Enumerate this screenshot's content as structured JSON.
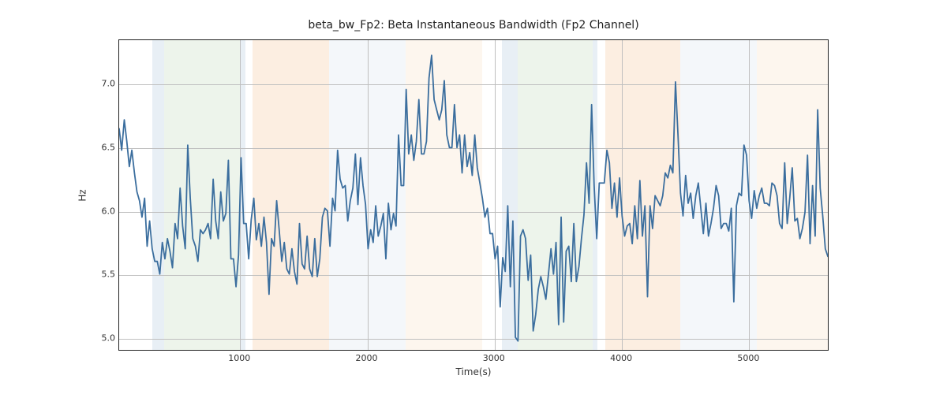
{
  "chart_data": {
    "type": "line",
    "title": "beta_bw_Fp2: Beta Instantaneous Bandwidth (Fp2 Channel)",
    "xlabel": "Time(s)",
    "ylabel": "Hz",
    "xlim": [
      50,
      5630
    ],
    "ylim": [
      4.9,
      7.35
    ],
    "xticks": [
      1000,
      2000,
      3000,
      4000,
      5000
    ],
    "yticks": [
      5.0,
      5.5,
      6.0,
      6.5,
      7.0
    ],
    "line_color": "#3b6e9e",
    "bands": [
      {
        "x0": 310,
        "x1": 405,
        "color": "#b2c9de"
      },
      {
        "x0": 405,
        "x1": 1000,
        "color": "#c3dcbc"
      },
      {
        "x0": 1000,
        "x1": 1040,
        "color": "#b2c9de"
      },
      {
        "x0": 1100,
        "x1": 1700,
        "color": "#f4c89a"
      },
      {
        "x0": 1700,
        "x1": 2300,
        "color": "#dbe6ef"
      },
      {
        "x0": 2300,
        "x1": 2900,
        "color": "#f8e1c8"
      },
      {
        "x0": 3060,
        "x1": 3180,
        "color": "#b2c9de"
      },
      {
        "x0": 3180,
        "x1": 3770,
        "color": "#c3dcbc"
      },
      {
        "x0": 3770,
        "x1": 3810,
        "color": "#b2c9de"
      },
      {
        "x0": 3870,
        "x1": 4460,
        "color": "#f4c89a"
      },
      {
        "x0": 4460,
        "x1": 5060,
        "color": "#dbe6ef"
      },
      {
        "x0": 5060,
        "x1": 5630,
        "color": "#f8e1c8"
      }
    ],
    "series": [
      {
        "name": "beta_bw_Fp2",
        "x": [
          50,
          70,
          90,
          110,
          130,
          150,
          170,
          190,
          210,
          230,
          250,
          270,
          290,
          310,
          330,
          350,
          370,
          390,
          410,
          430,
          450,
          470,
          490,
          510,
          530,
          550,
          570,
          590,
          610,
          630,
          650,
          670,
          690,
          710,
          730,
          750,
          770,
          790,
          810,
          830,
          850,
          870,
          890,
          910,
          930,
          950,
          970,
          990,
          1010,
          1030,
          1050,
          1070,
          1090,
          1110,
          1130,
          1150,
          1170,
          1190,
          1210,
          1230,
          1250,
          1270,
          1290,
          1310,
          1330,
          1350,
          1370,
          1390,
          1410,
          1430,
          1450,
          1470,
          1490,
          1510,
          1530,
          1550,
          1570,
          1590,
          1610,
          1630,
          1650,
          1670,
          1690,
          1710,
          1730,
          1750,
          1770,
          1790,
          1810,
          1830,
          1850,
          1870,
          1890,
          1910,
          1930,
          1950,
          1970,
          1990,
          2010,
          2030,
          2050,
          2070,
          2090,
          2110,
          2130,
          2150,
          2170,
          2190,
          2210,
          2230,
          2250,
          2270,
          2290,
          2310,
          2330,
          2350,
          2370,
          2390,
          2410,
          2430,
          2450,
          2470,
          2490,
          2510,
          2530,
          2550,
          2570,
          2590,
          2610,
          2630,
          2650,
          2670,
          2690,
          2710,
          2730,
          2750,
          2770,
          2790,
          2810,
          2830,
          2850,
          2870,
          2890,
          2910,
          2930,
          2950,
          2970,
          2990,
          3010,
          3030,
          3050,
          3070,
          3090,
          3110,
          3130,
          3150,
          3170,
          3190,
          3210,
          3230,
          3250,
          3270,
          3290,
          3310,
          3330,
          3350,
          3370,
          3390,
          3410,
          3430,
          3450,
          3470,
          3490,
          3510,
          3530,
          3550,
          3570,
          3590,
          3610,
          3630,
          3650,
          3670,
          3690,
          3710,
          3730,
          3750,
          3770,
          3790,
          3810,
          3830,
          3850,
          3870,
          3890,
          3910,
          3930,
          3950,
          3970,
          3990,
          4010,
          4030,
          4050,
          4070,
          4090,
          4110,
          4130,
          4150,
          4170,
          4190,
          4210,
          4230,
          4250,
          4270,
          4290,
          4310,
          4330,
          4350,
          4370,
          4390,
          4410,
          4430,
          4450,
          4470,
          4490,
          4510,
          4530,
          4550,
          4570,
          4590,
          4610,
          4630,
          4650,
          4670,
          4690,
          4710,
          4730,
          4750,
          4770,
          4790,
          4810,
          4830,
          4850,
          4870,
          4890,
          4910,
          4930,
          4950,
          4970,
          4990,
          5010,
          5030,
          5050,
          5070,
          5090,
          5110,
          5130,
          5150,
          5170,
          5190,
          5210,
          5230,
          5250,
          5270,
          5290,
          5310,
          5330,
          5350,
          5370,
          5390,
          5410,
          5430,
          5450,
          5470,
          5490,
          5510,
          5530,
          5550,
          5570,
          5590,
          5610,
          5630
        ],
        "y": [
          6.65,
          6.48,
          6.72,
          6.55,
          6.35,
          6.48,
          6.3,
          6.15,
          6.08,
          5.95,
          6.1,
          5.72,
          5.92,
          5.7,
          5.6,
          5.6,
          5.5,
          5.75,
          5.62,
          5.78,
          5.68,
          5.55,
          5.9,
          5.78,
          6.18,
          5.88,
          5.7,
          6.52,
          6.1,
          5.78,
          5.72,
          5.6,
          5.85,
          5.82,
          5.85,
          5.9,
          5.78,
          6.25,
          5.92,
          5.78,
          6.15,
          5.92,
          5.98,
          6.4,
          5.62,
          5.62,
          5.4,
          5.65,
          6.42,
          5.9,
          5.9,
          5.62,
          5.93,
          6.1,
          5.77,
          5.9,
          5.72,
          5.95,
          5.75,
          5.34,
          5.78,
          5.72,
          6.08,
          5.85,
          5.6,
          5.75,
          5.54,
          5.5,
          5.7,
          5.52,
          5.42,
          5.9,
          5.58,
          5.54,
          5.8,
          5.54,
          5.48,
          5.78,
          5.48,
          5.62,
          5.95,
          6.02,
          6.0,
          5.72,
          6.1,
          6.0,
          6.48,
          6.25,
          6.18,
          6.2,
          5.92,
          6.08,
          6.18,
          6.45,
          6.05,
          6.42,
          6.2,
          6.05,
          5.7,
          5.85,
          5.75,
          6.04,
          5.8,
          5.88,
          5.98,
          5.62,
          6.06,
          5.85,
          5.98,
          5.88,
          6.6,
          6.2,
          6.2,
          6.96,
          6.45,
          6.6,
          6.4,
          6.55,
          6.88,
          6.45,
          6.45,
          6.55,
          7.05,
          7.23,
          6.88,
          6.8,
          6.72,
          6.8,
          7.03,
          6.6,
          6.5,
          6.5,
          6.84,
          6.5,
          6.6,
          6.3,
          6.6,
          6.35,
          6.46,
          6.28,
          6.6,
          6.34,
          6.22,
          6.1,
          5.95,
          6.02,
          5.82,
          5.82,
          5.62,
          5.72,
          5.24,
          5.63,
          5.52,
          6.04,
          5.4,
          5.92,
          5.0,
          4.97,
          5.8,
          5.85,
          5.78,
          5.45,
          5.65,
          5.05,
          5.18,
          5.38,
          5.48,
          5.4,
          5.3,
          5.5,
          5.7,
          5.5,
          5.75,
          5.1,
          5.95,
          5.12,
          5.68,
          5.72,
          5.44,
          5.9,
          5.44,
          5.56,
          5.78,
          5.97,
          6.38,
          6.06,
          6.84,
          6.2,
          5.78,
          6.22,
          6.22,
          6.22,
          6.48,
          6.38,
          6.02,
          6.22,
          5.95,
          6.26,
          5.96,
          5.8,
          5.88,
          5.9,
          5.74,
          6.04,
          5.78,
          6.24,
          5.8,
          6.04,
          5.32,
          6.04,
          5.86,
          6.12,
          6.08,
          6.04,
          6.12,
          6.3,
          6.26,
          6.36,
          6.3,
          7.02,
          6.6,
          6.14,
          5.96,
          6.28,
          6.06,
          6.14,
          5.94,
          6.12,
          6.22,
          6.02,
          5.82,
          6.06,
          5.8,
          5.9,
          6.02,
          6.2,
          6.12,
          5.86,
          5.9,
          5.9,
          5.84,
          6.02,
          5.28,
          6.04,
          6.14,
          6.12,
          6.52,
          6.44,
          6.08,
          5.94,
          6.16,
          6.02,
          6.12,
          6.18,
          6.06,
          6.06,
          6.04,
          6.22,
          6.2,
          6.12,
          5.9,
          5.86,
          6.38,
          5.9,
          6.1,
          6.34,
          5.92,
          5.94,
          5.78,
          5.86,
          5.99,
          6.44,
          5.74,
          6.2,
          5.8,
          6.8,
          6.18,
          5.96,
          5.7,
          5.64
        ]
      }
    ]
  }
}
